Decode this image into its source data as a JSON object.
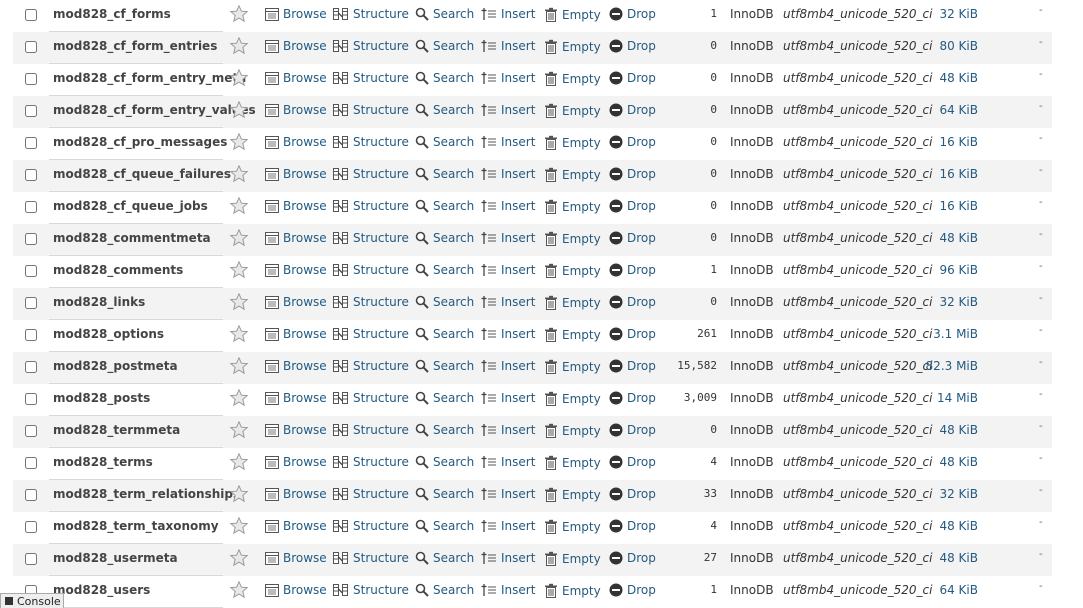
{
  "actions": {
    "browse": "Browse",
    "structure": "Structure",
    "search": "Search",
    "insert": "Insert",
    "empty": "Empty",
    "drop": "Drop"
  },
  "console": {
    "label": "Console"
  },
  "colors": {
    "link": "#235a81",
    "drop_icon": "#333333",
    "row_alt": "#f3f3f3"
  },
  "icons": [
    "checkbox",
    "star-icon",
    "browse-icon",
    "structure-icon",
    "search-icon",
    "insert-icon",
    "empty-icon",
    "drop-icon",
    "console-icon"
  ],
  "tables": [
    {
      "name": "mod828_cf_forms",
      "rows": "1",
      "engine": "InnoDB",
      "collation": "utf8mb4_unicode_520_ci",
      "size": "32 KiB",
      "overhead": "-"
    },
    {
      "name": "mod828_cf_form_entries",
      "rows": "0",
      "engine": "InnoDB",
      "collation": "utf8mb4_unicode_520_ci",
      "size": "80 KiB",
      "overhead": "-"
    },
    {
      "name": "mod828_cf_form_entry_meta",
      "rows": "0",
      "engine": "InnoDB",
      "collation": "utf8mb4_unicode_520_ci",
      "size": "48 KiB",
      "overhead": "-"
    },
    {
      "name": "mod828_cf_form_entry_values",
      "rows": "0",
      "engine": "InnoDB",
      "collation": "utf8mb4_unicode_520_ci",
      "size": "64 KiB",
      "overhead": "-"
    },
    {
      "name": "mod828_cf_pro_messages",
      "rows": "0",
      "engine": "InnoDB",
      "collation": "utf8mb4_unicode_520_ci",
      "size": "16 KiB",
      "overhead": "-"
    },
    {
      "name": "mod828_cf_queue_failures",
      "rows": "0",
      "engine": "InnoDB",
      "collation": "utf8mb4_unicode_520_ci",
      "size": "16 KiB",
      "overhead": "-"
    },
    {
      "name": "mod828_cf_queue_jobs",
      "rows": "0",
      "engine": "InnoDB",
      "collation": "utf8mb4_unicode_520_ci",
      "size": "16 KiB",
      "overhead": "-"
    },
    {
      "name": "mod828_commentmeta",
      "rows": "0",
      "engine": "InnoDB",
      "collation": "utf8mb4_unicode_520_ci",
      "size": "48 KiB",
      "overhead": "-"
    },
    {
      "name": "mod828_comments",
      "rows": "1",
      "engine": "InnoDB",
      "collation": "utf8mb4_unicode_520_ci",
      "size": "96 KiB",
      "overhead": "-"
    },
    {
      "name": "mod828_links",
      "rows": "0",
      "engine": "InnoDB",
      "collation": "utf8mb4_unicode_520_ci",
      "size": "32 KiB",
      "overhead": "-"
    },
    {
      "name": "mod828_options",
      "rows": "261",
      "engine": "InnoDB",
      "collation": "utf8mb4_unicode_520_ci",
      "size": "3.1 MiB",
      "overhead": "-"
    },
    {
      "name": "mod828_postmeta",
      "rows": "15,582",
      "engine": "InnoDB",
      "collation": "utf8mb4_unicode_520_ci",
      "size": "82.3 MiB",
      "overhead": "-"
    },
    {
      "name": "mod828_posts",
      "rows": "3,009",
      "engine": "InnoDB",
      "collation": "utf8mb4_unicode_520_ci",
      "size": "14 MiB",
      "overhead": "-"
    },
    {
      "name": "mod828_termmeta",
      "rows": "0",
      "engine": "InnoDB",
      "collation": "utf8mb4_unicode_520_ci",
      "size": "48 KiB",
      "overhead": "-"
    },
    {
      "name": "mod828_terms",
      "rows": "4",
      "engine": "InnoDB",
      "collation": "utf8mb4_unicode_520_ci",
      "size": "48 KiB",
      "overhead": "-"
    },
    {
      "name": "mod828_term_relationships",
      "rows": "33",
      "engine": "InnoDB",
      "collation": "utf8mb4_unicode_520_ci",
      "size": "32 KiB",
      "overhead": "-"
    },
    {
      "name": "mod828_term_taxonomy",
      "rows": "4",
      "engine": "InnoDB",
      "collation": "utf8mb4_unicode_520_ci",
      "size": "48 KiB",
      "overhead": "-"
    },
    {
      "name": "mod828_usermeta",
      "rows": "27",
      "engine": "InnoDB",
      "collation": "utf8mb4_unicode_520_ci",
      "size": "48 KiB",
      "overhead": "-"
    },
    {
      "name": "mod828_users",
      "rows": "1",
      "engine": "InnoDB",
      "collation": "utf8mb4_unicode_520_ci",
      "size": "64 KiB",
      "overhead": "-"
    }
  ]
}
